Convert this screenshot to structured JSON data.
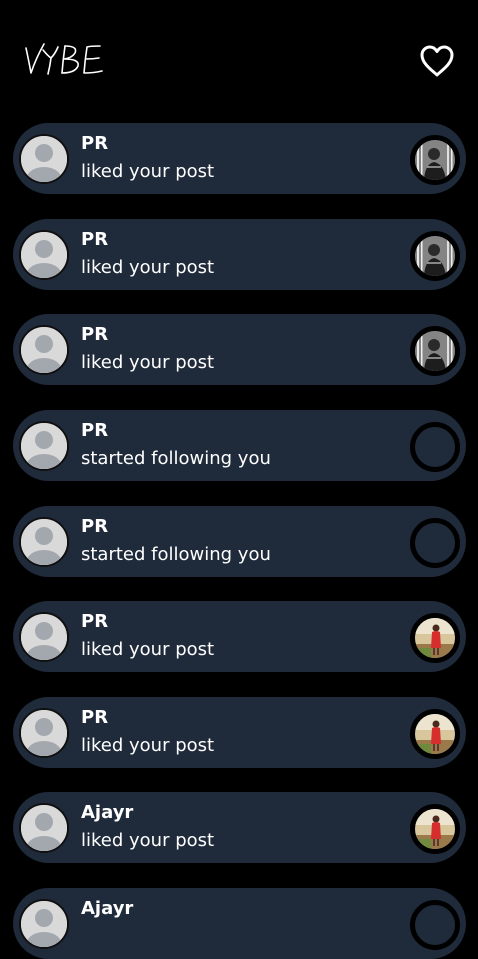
{
  "header": {
    "logo_text": "VYBE",
    "heart_icon": "heart-outline-icon"
  },
  "notifications": [
    {
      "name": "PR",
      "message": "liked your post",
      "thumb": "photo-bw"
    },
    {
      "name": "PR",
      "message": "liked your post",
      "thumb": "photo-bw"
    },
    {
      "name": "PR",
      "message": "liked your post",
      "thumb": "photo-bw"
    },
    {
      "name": "PR",
      "message": "started following you",
      "thumb": "empty"
    },
    {
      "name": "PR",
      "message": "started following you",
      "thumb": "empty"
    },
    {
      "name": "PR",
      "message": "liked your post",
      "thumb": "photo-color"
    },
    {
      "name": "PR",
      "message": "liked your post",
      "thumb": "photo-color"
    },
    {
      "name": "Ajayr",
      "message": "liked your post",
      "thumb": "photo-color"
    },
    {
      "name": "Ajayr",
      "message": "",
      "thumb": "empty"
    }
  ]
}
